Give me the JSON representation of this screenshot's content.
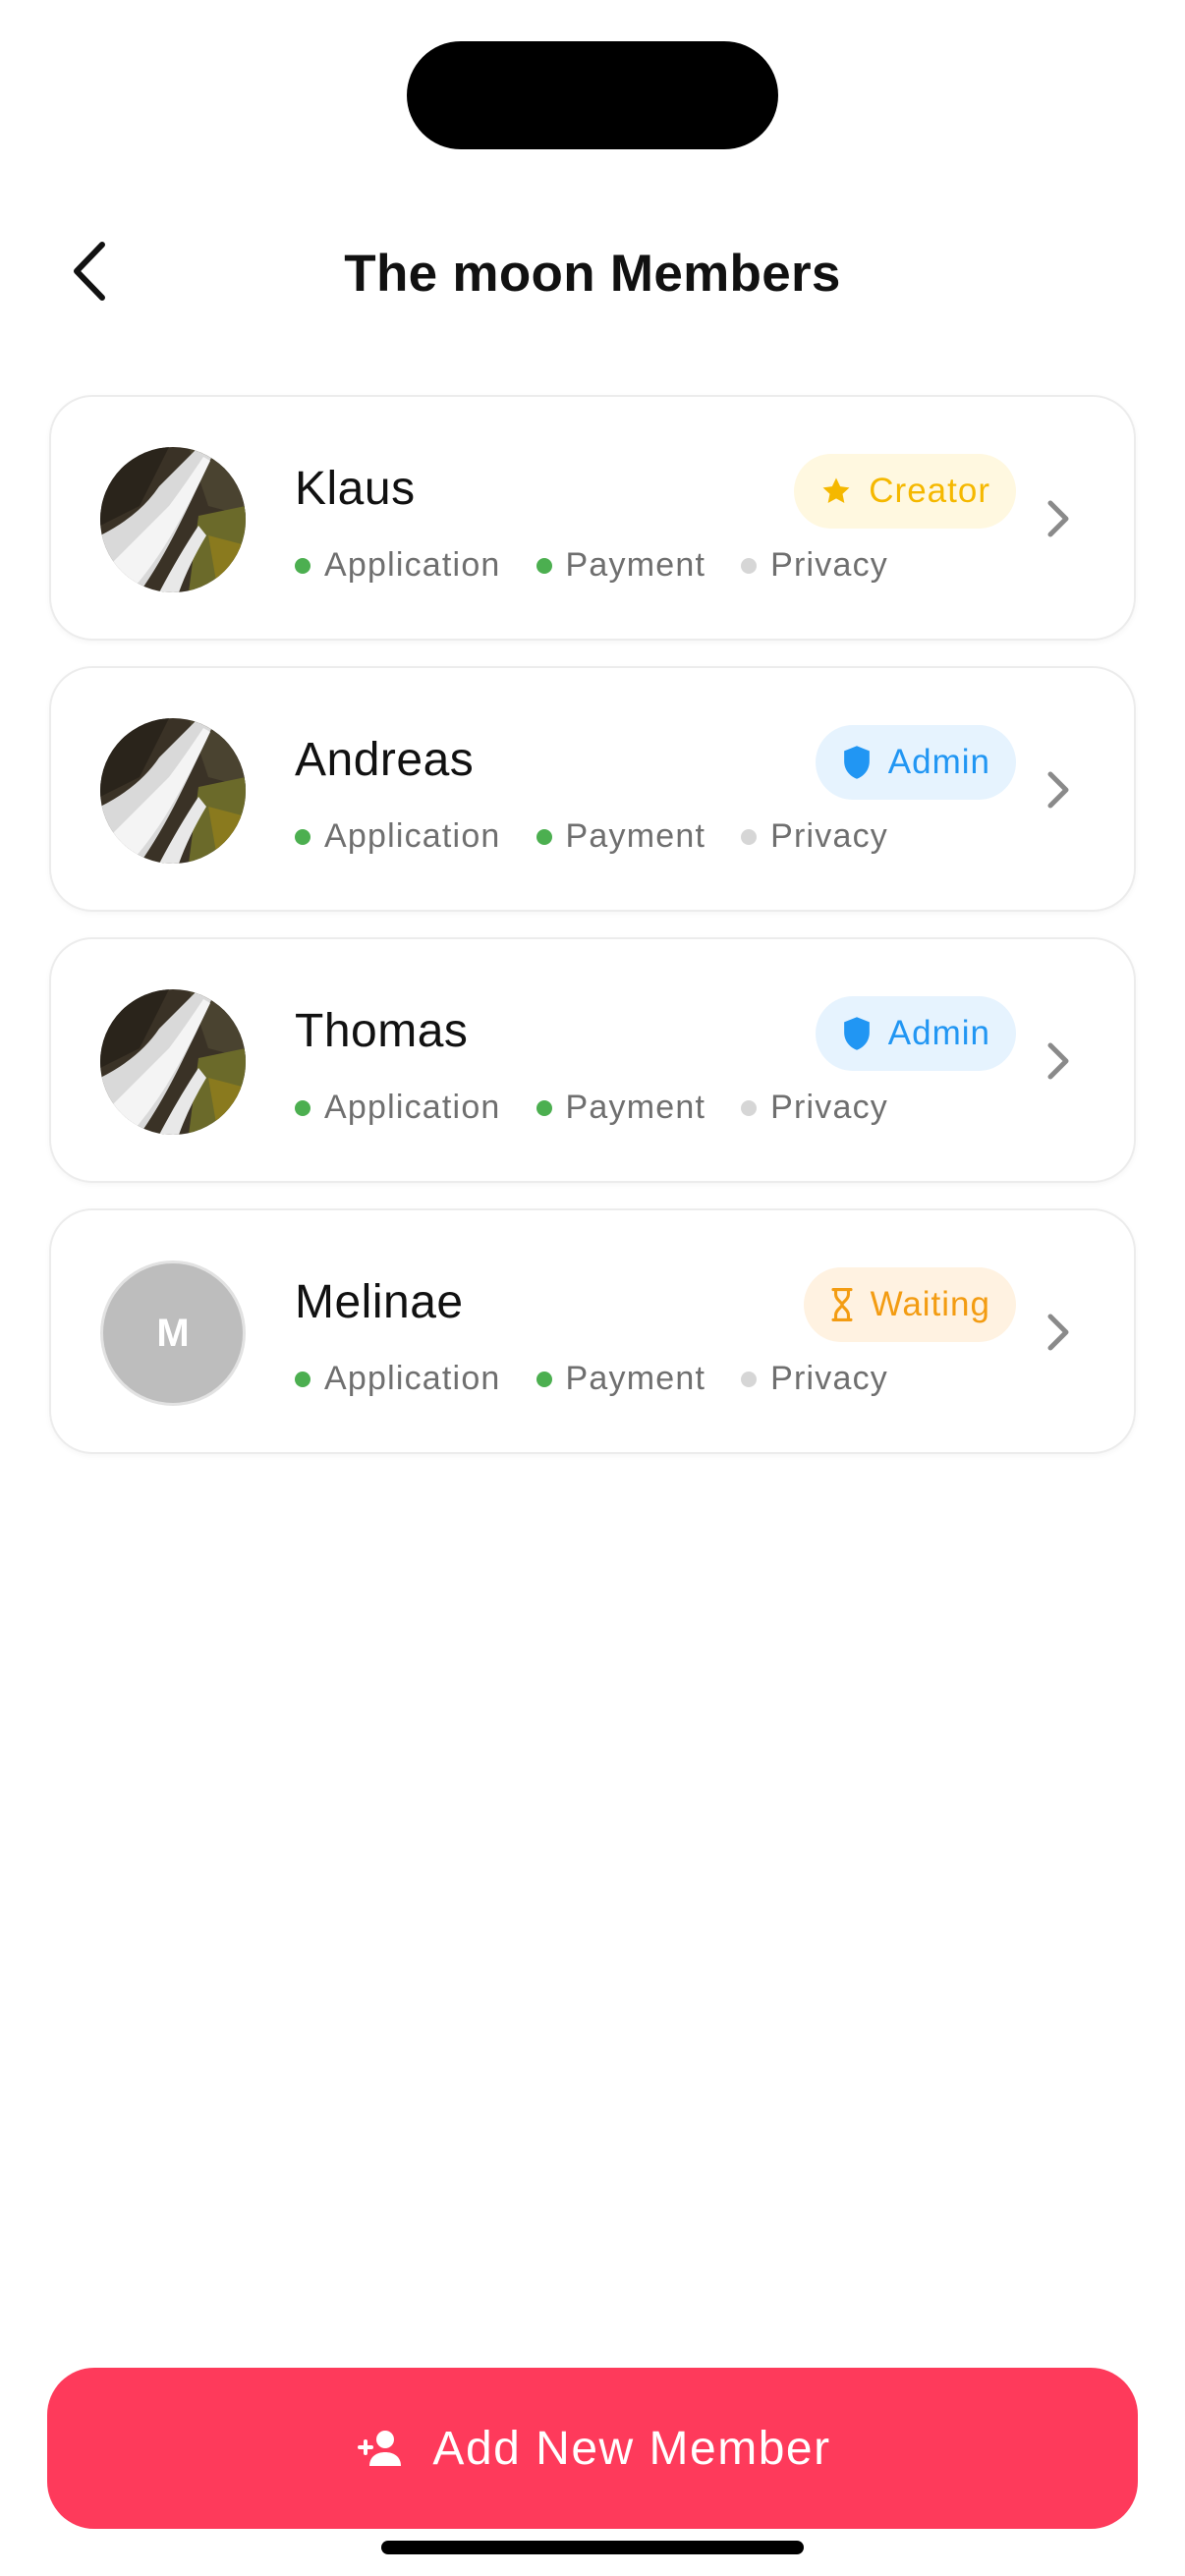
{
  "header": {
    "title": "The moon Members",
    "back_icon": "chevron-left-icon"
  },
  "status_labels": [
    "Application",
    "Payment",
    "Privacy"
  ],
  "colors": {
    "status_active": "#4caf50",
    "status_inactive": "#d6d6d6",
    "creator_bg": "#fff8e0",
    "creator_fg": "#f5b800",
    "admin_bg": "#e6f3fe",
    "admin_fg": "#2196f3",
    "waiting_bg": "#fff2e1",
    "waiting_fg": "#f39c12",
    "primary": "#fe3a5b"
  },
  "members": [
    {
      "name": "Klaus",
      "role": "Creator",
      "role_icon": "star-icon",
      "avatar": "photo",
      "statuses": [
        {
          "label": "Application",
          "active": true
        },
        {
          "label": "Payment",
          "active": true
        },
        {
          "label": "Privacy",
          "active": false
        }
      ]
    },
    {
      "name": "Andreas",
      "role": "Admin",
      "role_icon": "shield-icon",
      "avatar": "photo",
      "statuses": [
        {
          "label": "Application",
          "active": true
        },
        {
          "label": "Payment",
          "active": true
        },
        {
          "label": "Privacy",
          "active": false
        }
      ]
    },
    {
      "name": "Thomas",
      "role": "Admin",
      "role_icon": "shield-icon",
      "avatar": "photo",
      "statuses": [
        {
          "label": "Application",
          "active": true
        },
        {
          "label": "Payment",
          "active": true
        },
        {
          "label": "Privacy",
          "active": false
        }
      ]
    },
    {
      "name": "Melinae",
      "role": "Waiting",
      "role_icon": "hourglass-icon",
      "avatar": "initial",
      "initial": "M",
      "statuses": [
        {
          "label": "Application",
          "active": true
        },
        {
          "label": "Payment",
          "active": true
        },
        {
          "label": "Privacy",
          "active": false
        }
      ]
    }
  ],
  "footer": {
    "add_button_label": "Add New Member",
    "add_button_icon": "add-person-icon"
  }
}
